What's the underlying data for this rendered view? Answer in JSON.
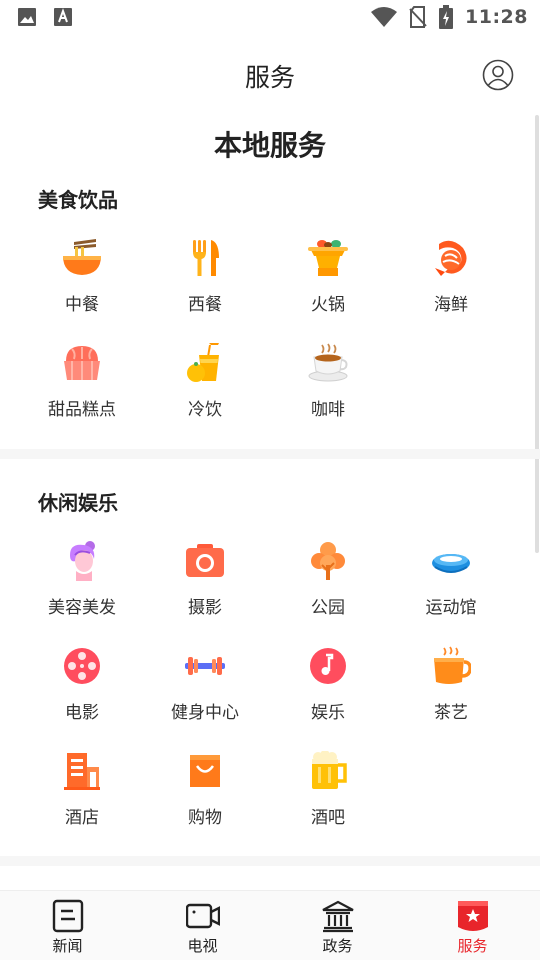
{
  "status_bar": {
    "time": "11:28",
    "icons": [
      "gallery-icon",
      "font-icon",
      "wifi-icon",
      "no-sim-icon",
      "battery-charging-icon"
    ]
  },
  "header": {
    "title": "服务",
    "account_icon": "user-circle-icon"
  },
  "page_heading": "本地服务",
  "sections": [
    {
      "title": "美食饮品",
      "items": [
        {
          "label": "中餐",
          "icon": "noodle-bowl-icon"
        },
        {
          "label": "西餐",
          "icon": "fork-knife-icon"
        },
        {
          "label": "火锅",
          "icon": "hotpot-icon"
        },
        {
          "label": "海鲜",
          "icon": "shrimp-icon"
        },
        {
          "label": "甜品糕点",
          "icon": "cake-icon"
        },
        {
          "label": "冷饮",
          "icon": "cold-drink-icon"
        },
        {
          "label": "咖啡",
          "icon": "coffee-icon"
        }
      ]
    },
    {
      "title": "休闲娱乐",
      "items": [
        {
          "label": "美容美发",
          "icon": "beauty-hair-icon"
        },
        {
          "label": "摄影",
          "icon": "camera-icon"
        },
        {
          "label": "公园",
          "icon": "tree-icon"
        },
        {
          "label": "运动馆",
          "icon": "stadium-icon"
        },
        {
          "label": "电影",
          "icon": "film-reel-icon"
        },
        {
          "label": "健身中心",
          "icon": "dumbbell-icon"
        },
        {
          "label": "娱乐",
          "icon": "music-note-icon"
        },
        {
          "label": "茶艺",
          "icon": "tea-cup-icon"
        },
        {
          "label": "酒店",
          "icon": "hotel-building-icon"
        },
        {
          "label": "购物",
          "icon": "shopping-bag-icon"
        },
        {
          "label": "酒吧",
          "icon": "beer-mug-icon"
        }
      ]
    }
  ],
  "tab_bar": {
    "tabs": [
      {
        "label": "新闻",
        "icon": "news-icon",
        "active": false
      },
      {
        "label": "电视",
        "icon": "video-camera-icon",
        "active": false
      },
      {
        "label": "政务",
        "icon": "government-building-icon",
        "active": false
      },
      {
        "label": "服务",
        "icon": "service-star-icon",
        "active": true
      }
    ],
    "active_color": "#e8252b"
  }
}
